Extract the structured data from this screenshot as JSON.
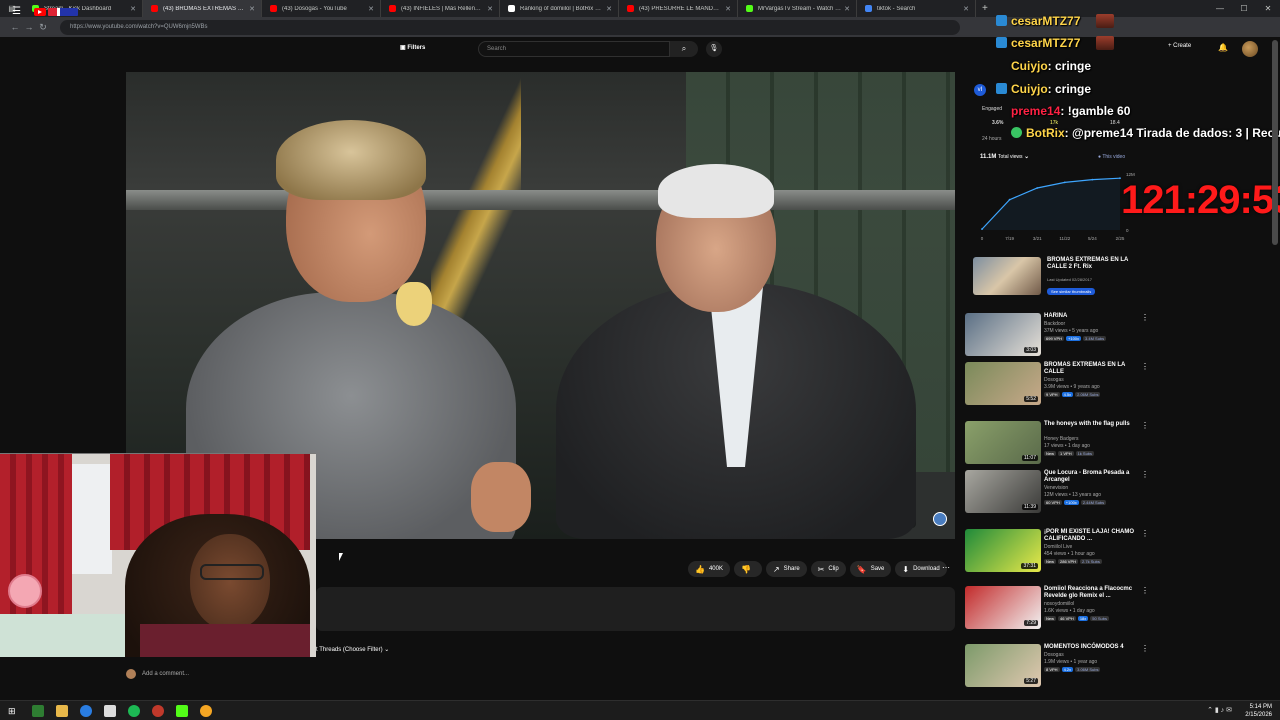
{
  "browser": {
    "tabs": [
      {
        "label": "Stream - Kick Dashboard",
        "color": "#53fc18"
      },
      {
        "label": "(43) BROMAS EXTREMAS EN LA C",
        "color": "#ff0000",
        "active": true
      },
      {
        "label": "(43) Dosogas - YouTube",
        "color": "#ff0000"
      },
      {
        "label": "(43) INFIELES | Más Rellena que P",
        "color": "#ff0000"
      },
      {
        "label": "Ranking of domiilol | BotRix — C",
        "color": "#ffffff"
      },
      {
        "label": "(43) PRESURRE LE MANDO FUEG",
        "color": "#ff0000"
      },
      {
        "label": "MrVargasTv Stream - Watch Live",
        "color": "#53fc18"
      },
      {
        "label": "tiktok - Search",
        "color": "#4285f4"
      }
    ],
    "url": "https://www.youtube.com/watch?v=QUW6mjn5WBs",
    "new_tab": "+"
  },
  "youtube": {
    "search_placeholder": "Search",
    "filters_label": "Filters",
    "create_label": "Create",
    "actions": {
      "likes": "400K",
      "share": "Share",
      "clip": "Clip",
      "save": "Save",
      "download": "Download"
    },
    "threads_label": "t Threads (Choose Filter)",
    "add_comment": "Add a comment..."
  },
  "analytics": {
    "stat1_label": "Engaged",
    "stat1_value": "3.6%",
    "stat2_value": "17k",
    "stat3_value": "18.4",
    "period": "24 hours",
    "views_total": "11.1M",
    "views_label": "Total views",
    "this_video": "This video",
    "y_max": "12M",
    "x_labels": [
      "0",
      "7/19",
      "3/21",
      "11/22",
      "5/24",
      "2/25"
    ]
  },
  "chart_data": {
    "type": "line",
    "title": "",
    "xlabel": "",
    "ylabel": "",
    "x": [
      "0",
      "7/19",
      "3/21",
      "11/22",
      "5/24",
      "2/25"
    ],
    "series": [
      {
        "name": "This video",
        "values": [
          0.2,
          6.5,
          9.0,
          10.2,
          10.8,
          11.1
        ]
      }
    ],
    "ylim": [
      0,
      12
    ],
    "grid": false,
    "legend": "top-right"
  },
  "chat": [
    {
      "user": "cesarMTZ77",
      "text": "",
      "user_color": "#ffd54a"
    },
    {
      "user": "cesarMTZ77",
      "text": "",
      "user_color": "#ffd54a"
    },
    {
      "user": "Cuiyjo",
      "text": ": cringe",
      "user_color": "#ffd54a"
    },
    {
      "user": "Cuiyjo",
      "text": ": cringe",
      "user_color": "#ffd54a"
    },
    {
      "user": "preme14",
      "text": ": !gamble 60",
      "user_color": "#ff2244"
    },
    {
      "user": "BotRix",
      "text": ": @preme14 Tirada de dados: 3 | Recupe",
      "user_color": "#ffd54a"
    }
  ],
  "timer": "121:29:53",
  "featured": {
    "title": "BROMAS EXTREMAS EN LA CALLE 2 Ft. Rix",
    "meta": "Last Updated 02/28/2017",
    "button": "See similar thumbnails"
  },
  "recommendations": [
    {
      "title": "HARINA",
      "channel": "Backdoor",
      "meta": "37M views • 5 years ago",
      "badges": [
        "699 VPH",
        "+100x",
        "3.4M Subs"
      ],
      "duration": "3:03",
      "thumb": [
        "#5a6f85",
        "#e7e1d8"
      ]
    },
    {
      "title": "BROMAS EXTREMAS EN LA CALLE",
      "channel": "Dosogas",
      "meta": "3.9M views • 9 years ago",
      "badges": [
        "9 VPH",
        "4.5x",
        "2.06M Subs"
      ],
      "duration": "5:52",
      "thumb": [
        "#7a8a5a",
        "#c8a98a"
      ]
    },
    {
      "title": "The honeys with the flag pulls",
      "channel": "Honey Badgers",
      "meta": "17 views • 1 day ago",
      "badges": [
        "New",
        "1 VPH",
        "1k Subs"
      ],
      "duration": "11:07",
      "thumb": [
        "#8aa06a",
        "#5a6a4a"
      ]
    },
    {
      "title": "Que Locura - Broma Pesada a Arcangel",
      "channel": "Venevision",
      "meta": "12M views • 13 years ago",
      "badges": [
        "60 VPH",
        "+100x",
        "2.44M Subs"
      ],
      "duration": "11:39",
      "thumb": [
        "#a8a7a0",
        "#3a3a38"
      ]
    },
    {
      "title": "¡POR MI EXISTE LAJA! CHAMO CALIFICANDO ...",
      "channel": "Domiilol Live",
      "meta": "454 views • 1 hour ago",
      "badges": [
        "New",
        "286 VPH",
        "2.7k Subs"
      ],
      "duration": "37:31",
      "thumb": [
        "#1f8a3a",
        "#e9e94a"
      ]
    },
    {
      "title": "Domiiol Reacciona a Flacocmc Revelde glo Remix el ...",
      "channel": "nosoydomiilol",
      "meta": "1.6K views • 1 day ago",
      "badges": [
        "New",
        "46 VPH",
        "18x",
        "50 Subs"
      ],
      "duration": "7:29",
      "thumb": [
        "#c22a2a",
        "#f2f2f2"
      ]
    },
    {
      "title": "MOMENTOS INCÓMODOS 4",
      "channel": "Dosogas",
      "meta": "1.9M views • 1 year ago",
      "badges": [
        "8 VPH",
        "4.2x",
        "3.06M Subs"
      ],
      "duration": "5:27",
      "thumb": [
        "#7c9a6a",
        "#e0c8b0"
      ]
    }
  ],
  "taskbar": {
    "time": "5:14 PM",
    "date": "2/15/2026"
  },
  "colors": {
    "accent": "#ff0000",
    "timer": "#ff1a1a",
    "link": "#3ea6ff"
  }
}
